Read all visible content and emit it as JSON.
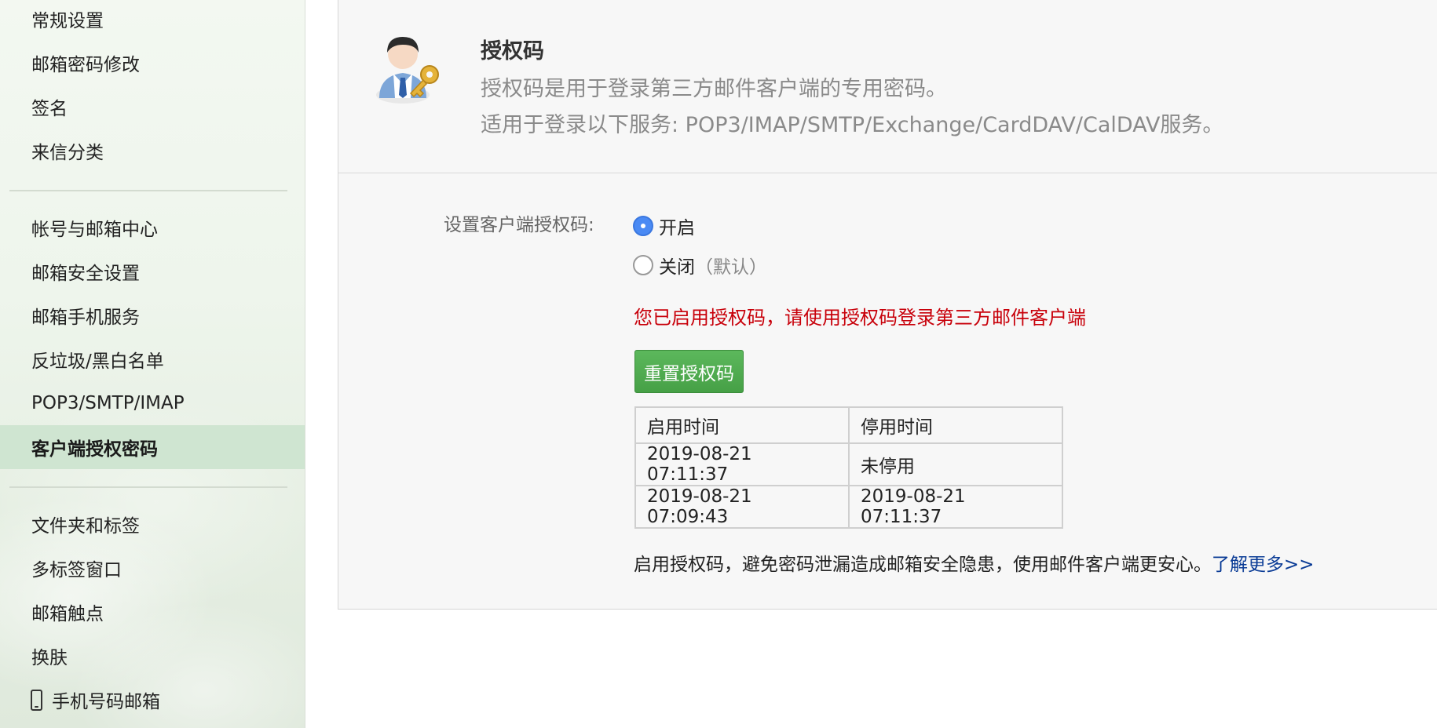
{
  "sidebar": {
    "items": [
      {
        "label": "常规设置"
      },
      {
        "label": "邮箱密码修改"
      },
      {
        "label": "签名"
      },
      {
        "label": "来信分类"
      },
      {
        "label": "帐号与邮箱中心"
      },
      {
        "label": "邮箱安全设置"
      },
      {
        "label": "邮箱手机服务"
      },
      {
        "label": "反垃圾/黑白名单"
      },
      {
        "label": "POP3/SMTP/IMAP"
      },
      {
        "label": "客户端授权密码"
      },
      {
        "label": "文件夹和标签"
      },
      {
        "label": "多标签窗口"
      },
      {
        "label": "邮箱触点"
      },
      {
        "label": "换肤"
      },
      {
        "label": "手机号码邮箱",
        "icon": "mobile-phone-icon"
      }
    ],
    "active_label": "客户端授权密码",
    "active_color": "#cfe5d1"
  },
  "header": {
    "icon": "user-key-icon",
    "title": "授权码",
    "line1": "授权码是用于登录第三方邮件客户端的专用密码。",
    "line2": "适用于登录以下服务: POP3/IMAP/SMTP/Exchange/CardDAV/CalDAV服务。"
  },
  "setting": {
    "label": "设置客户端授权码:",
    "option_on": "开启",
    "option_off": "关闭",
    "option_off_note": "（默认）",
    "selected": "开启"
  },
  "notice": {
    "text": "您已启用授权码，请使用授权码登录第三方邮件客户端",
    "color": "#c8000a"
  },
  "reset_button": {
    "label": "重置授权码",
    "color": "#4cab4c"
  },
  "history_table": {
    "headers": [
      "启用时间",
      "停用时间"
    ],
    "rows": [
      [
        "2019-08-21 07:11:37",
        "未停用"
      ],
      [
        "2019-08-21 07:09:43",
        "2019-08-21 07:11:37"
      ]
    ]
  },
  "footer": {
    "text": "启用授权码，避免密码泄漏造成邮箱安全隐患，使用邮件客户端更安心。",
    "link": "了解更多>>",
    "link_color": "#0b3c96"
  }
}
